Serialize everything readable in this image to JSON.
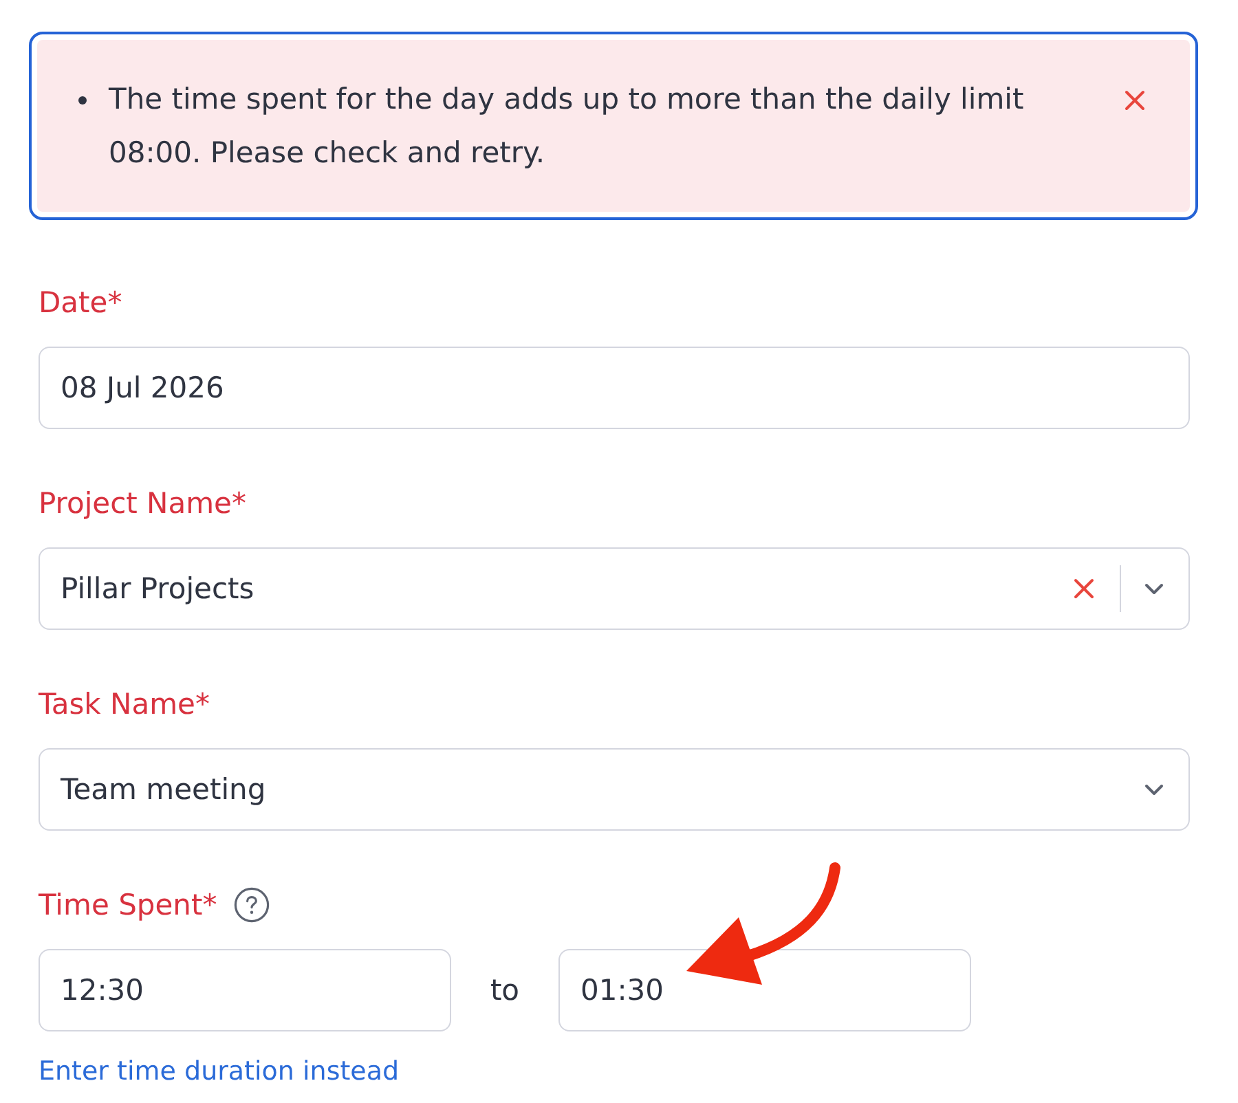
{
  "alert": {
    "messages": [
      "The time spent for the day adds up to more than the daily limit 08:00. Please check and retry."
    ],
    "dismissible": true
  },
  "fields": [
    {
      "kind": "text",
      "label": "Date*",
      "value": "08 Jul 2026"
    },
    {
      "kind": "select",
      "label": "Project Name*",
      "value": "Pillar Projects",
      "clearable": true
    },
    {
      "kind": "select",
      "label": "Task Name*",
      "value": "Team meeting",
      "clearable": false
    },
    {
      "kind": "time_range",
      "label": "Time Spent*",
      "help": true,
      "from": "12:30",
      "separator": "to",
      "to": "01:30",
      "link": "Enter time duration instead"
    }
  ],
  "annotations": [
    {
      "kind": "arrow"
    }
  ]
}
